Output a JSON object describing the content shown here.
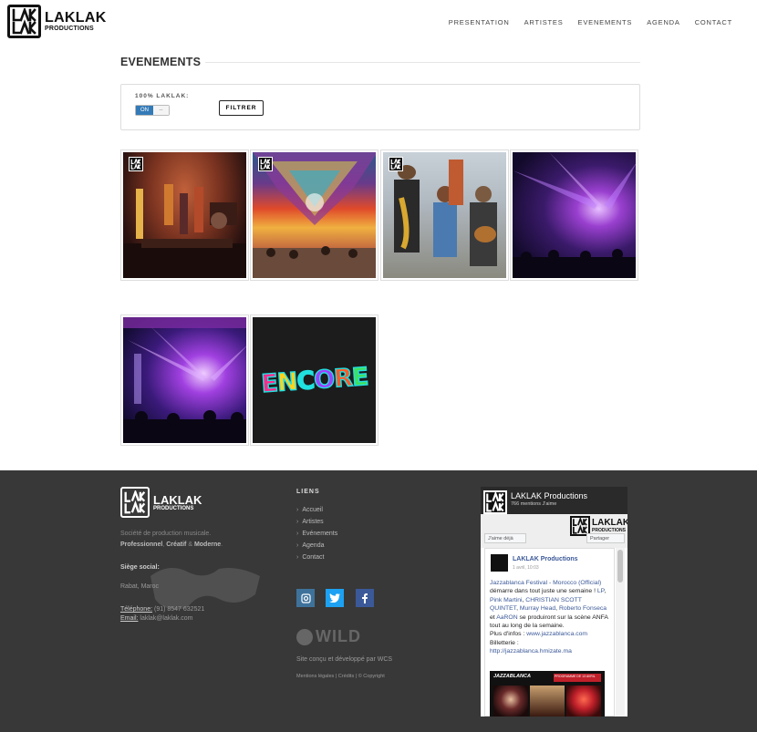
{
  "brand": {
    "name": "LAKLAK",
    "sub": "PRODUCTIONS"
  },
  "nav": [
    "PRESENTATION",
    "ARTISTES",
    "EVENEMENTS",
    "AGENDA",
    "CONTACT"
  ],
  "page": {
    "title": "EVENEMENTS"
  },
  "filter": {
    "label": "100% LAKLAK:",
    "toggle_on": "ON",
    "toggle_off": "--",
    "button": "FILTRER"
  },
  "events": [
    {
      "name": "event-concert-stage"
    },
    {
      "name": "event-festival-crowd"
    },
    {
      "name": "event-street-band"
    },
    {
      "name": "event-light-show"
    },
    {
      "name": "event-stage-lights"
    },
    {
      "name": "event-encore"
    }
  ],
  "encore_text": "ENCORE",
  "footer": {
    "desc_line1": "Société de production musicale.",
    "desc_bold1": "Professionnel",
    "desc_bold2": "Créatif",
    "desc_bold3": "Moderne",
    "seat_label": "Siège social:",
    "seat": "Rabat, Maroc",
    "phone_label": "Téléphone:",
    "phone": "(91) 8547 632521",
    "email_label": "Email:",
    "email": "laklak@laklak.com",
    "links_title": "LIENS",
    "links": [
      "Accueil",
      "Artistes",
      "Evénements",
      "Agenda",
      "Contact"
    ],
    "wild": "WILD",
    "credit": "Site conçu et développé par WCS",
    "legal": [
      "Mentions légales",
      "Crédits",
      "© Copyright"
    ]
  },
  "fb": {
    "page_name": "LAKLAK Productions",
    "likes": "766 mentions J'aime",
    "like_btn": "J'aime déjà",
    "share_btn": "Partager",
    "post_name": "LAKLAK Productions",
    "post_date": "1 avril, 10:03",
    "post_l1": "Jazzablanca Festival - Morocco",
    "post_l2": "(Official)",
    "post_t2": " démarre dans tout juste une semaine ! ",
    "post_l3": "LP",
    "post_l4": "Pink Martini",
    "post_l5": "CHRISTIAN SCOTT QUINTET",
    "post_l6": "Murray Head",
    "post_l7": "Roberto Fonseca",
    "post_t3": " et ",
    "post_l8": "AaRON",
    "post_t4": " se produiront sur la scène ANFA tout au long de la semaine.",
    "post_t5": "Plus d'infos : ",
    "post_l9": "www.jazzablanca.com",
    "post_t6": "Billetterie :",
    "post_l10": "http://jazzablanca.hmizate.ma",
    "post_img_title": "JAZZABLANCA",
    "post_img_sub": "PROGRAMME DE 13 AVRIL"
  },
  "colors": {
    "accent": "#337ab7",
    "footer_bg": "#383838",
    "instagram": "#3f729b",
    "twitter": "#1da1f2",
    "facebook": "#3b5998"
  }
}
